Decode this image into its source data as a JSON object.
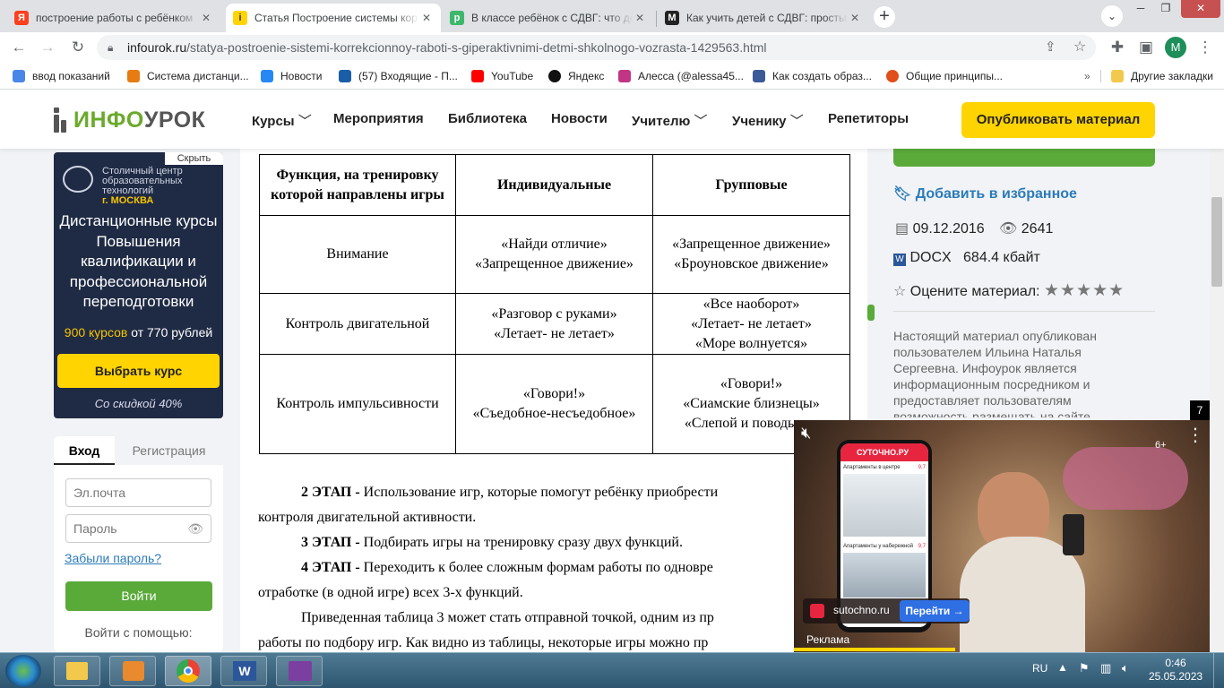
{
  "tabs": [
    {
      "title": "построение работы с ребёнком",
      "favicon": "Я",
      "color": "#fc3f1d",
      "active": false
    },
    {
      "title": "Статья Построение системы кор",
      "favicon": "i",
      "color": "#ffd400",
      "active": true
    },
    {
      "title": "В классе ребёнок с СДВГ: что де",
      "favicon": "p",
      "color": "#3db86b",
      "active": false
    },
    {
      "title": "Как учить детей с СДВГ: просты",
      "favicon": "M",
      "color": "#222222",
      "active": false
    }
  ],
  "toolbar": {
    "url_host": "infourok.ru",
    "url_path": "/statya-postroenie-sistemi-korrekcionnoy-raboti-s-giperaktivnimi-detmi-shkolnogo-vozrasta-1429563.html",
    "profile": "М"
  },
  "bookmarks": [
    {
      "label": "ввод показаний",
      "color": "#4a86e8"
    },
    {
      "label": "Система дистанци...",
      "color": "#e67c13"
    },
    {
      "label": "Новости",
      "color": "#2787f5"
    },
    {
      "label": "(57) Входящие - П...",
      "color": "#1a5ea8"
    },
    {
      "label": "YouTube",
      "color": "#ff0000"
    },
    {
      "label": "Яндекс",
      "color": "#111111"
    },
    {
      "label": "Алесса (@alessa45...",
      "color": "#c13584"
    },
    {
      "label": "Как создать образ...",
      "color": "#3d5a98"
    },
    {
      "label": "Общие принципы...",
      "color": "#e04e1b"
    }
  ],
  "bookmarks_other": "Другие закладки",
  "site": {
    "logo_a": "ИНФО",
    "logo_b": "УРОК",
    "nav": [
      "Курсы",
      "Мероприятия",
      "Библиотека",
      "Новости",
      "Учителю",
      "Ученику",
      "Репетиторы"
    ],
    "publish": "Опубликовать материал"
  },
  "ad": {
    "hide": "Скрыть",
    "org_line1": "Столичный центр",
    "org_line2": "образовательных",
    "org_line3": "технологий",
    "city": "г. МОСКВА",
    "title": "Дистанционные курсы Повышения квалификации и профессиональной переподготовки",
    "count": "900 курсов",
    "price": "от 770 рублей",
    "cta": "Выбрать курс",
    "discount": "Со скидкой 40%"
  },
  "login": {
    "tab_login": "Вход",
    "tab_register": "Регистрация",
    "email_placeholder": "Эл.почта",
    "password_placeholder": "Пароль",
    "forgot": "Забыли пароль?",
    "submit": "Войти",
    "via": "Войти с помощью:"
  },
  "table": {
    "headers": [
      "Функция, на тренировку которой направлены игры",
      "Индивидуальные",
      "Групповые"
    ],
    "rows": [
      [
        "Внимание",
        "«Найди отличие»\n«Запрещенное движение»",
        "«Запрещенное движение»\n«Броуновское движение»"
      ],
      [
        "Контроль двигательной",
        "«Разговор с руками»\n«Летает- не летает»",
        "«Все наоборот»\n«Летает- не летает»\n«Море волнуется»"
      ],
      [
        "Контроль импульсивности",
        "«Говори!»\n«Съедобное-несъедобное»",
        "«Говори!»\n«Сиамские близнецы»\n«Слепой и поводырь»"
      ]
    ]
  },
  "paras": [
    {
      "bold": "2 ЭТАП - ",
      "text": "Использование игр, которые помогут ребёнку приобрести",
      "indent": true
    },
    {
      "bold": "",
      "text": "контроля двигательной активности.",
      "indent": false
    },
    {
      "bold": "3 ЭТАП - ",
      "text": "Подбирать игры на тренировку сразу двух функций.",
      "indent": true
    },
    {
      "bold": "4 ЭТАП - ",
      "text": "Переходить к более сложным формам работы по одновре",
      "indent": true
    },
    {
      "bold": "",
      "text": "отработке (в одной игре) всех 3-х функций.",
      "indent": false
    },
    {
      "bold": "",
      "text": "Приведенная таблица 3 может стать отправной точкой, одним из пр",
      "indent": true
    },
    {
      "bold": "",
      "text": "работы по подбору игр. Как видно из таблицы, некоторые игры можно пр",
      "indent": false
    }
  ],
  "sidebar": {
    "favorite": "Добавить в избранное",
    "date": "09.12.2016",
    "views": "2641",
    "format": "DOCX",
    "size": "684.4 кбайт",
    "rate": "Оцените материал:",
    "rating": 0,
    "notice": "Настоящий материал опубликован пользователем Ильина Наталья Сергеевна. Инфоурок является информационным посредником и предоставляет пользователям возможность размещать на сайте"
  },
  "video": {
    "counter": "7",
    "age": "6+",
    "brand": "СУТОЧНО.РУ",
    "site": "sutochno.ru",
    "go": "Перейти →",
    "label": "Реклама",
    "card1": "Апартаменты в центре",
    "card2": "Апартаменты у набережной",
    "rating1": "9,7",
    "rating2": "9,7"
  },
  "taskbar": {
    "lang": "RU",
    "time": "0:46",
    "date": "25.05.2023"
  }
}
